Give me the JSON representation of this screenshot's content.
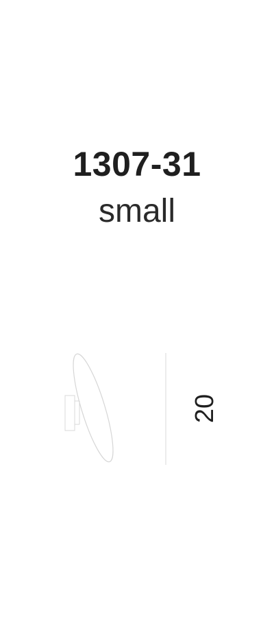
{
  "product": {
    "code": "1307-31",
    "size": "small"
  },
  "dimension": {
    "value": "20"
  },
  "colors": {
    "text": "#1f1f1f",
    "drawing_lines": "#d6d6d6"
  }
}
